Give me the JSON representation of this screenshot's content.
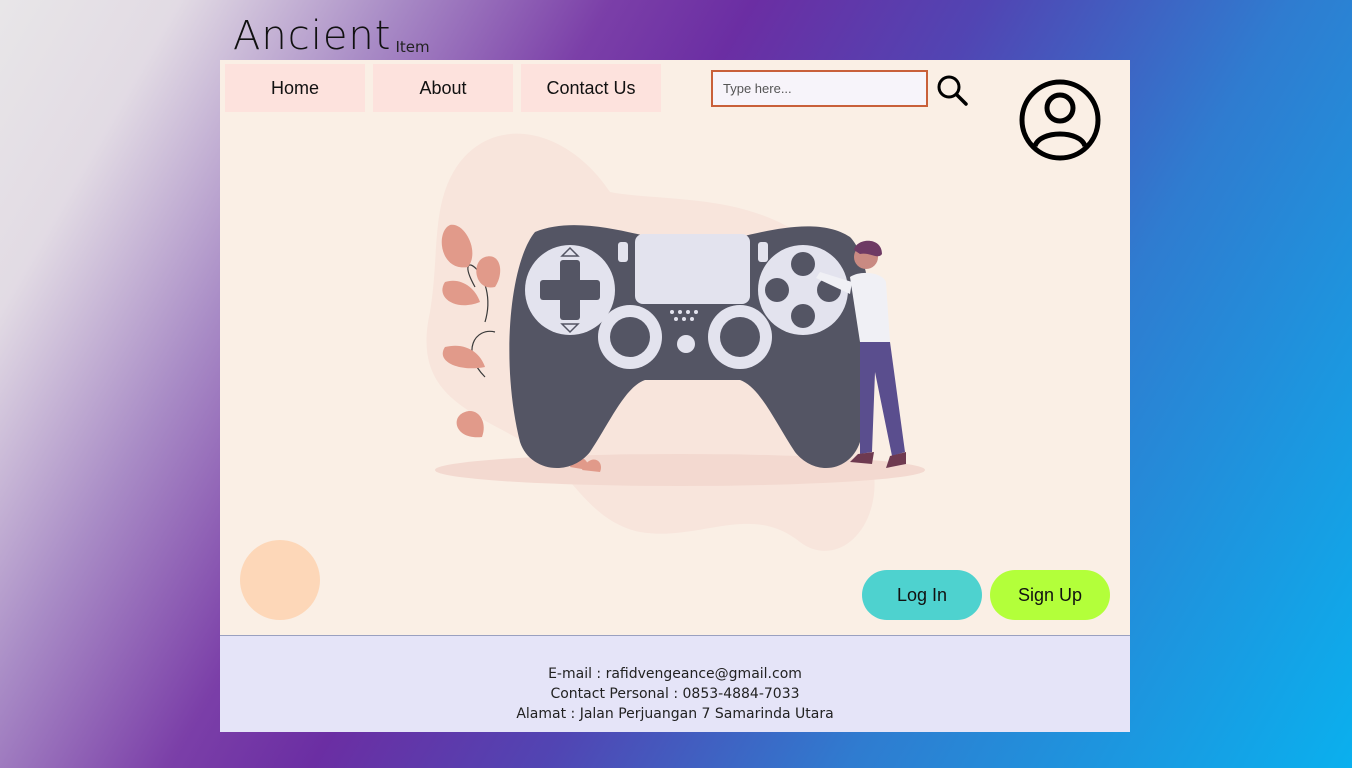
{
  "brand": {
    "name": "Ancient",
    "tag": "Item"
  },
  "nav": {
    "items": [
      {
        "label": "Home"
      },
      {
        "label": "About"
      },
      {
        "label": "Contact Us"
      }
    ]
  },
  "search": {
    "placeholder": "Type here...",
    "value": "",
    "icon": "search-icon"
  },
  "user": {
    "icon": "user-circle-icon"
  },
  "hero": {
    "image": "gamepad-illustration"
  },
  "buttons": {
    "login": "Log In",
    "signup": "Sign Up"
  },
  "footer": {
    "email": "E-mail : rafidvengeance@gmail.com",
    "phone": "Contact Personal : 0853-4884-7033",
    "address": "Alamat : Jalan Perjuangan 7 Samarinda Utara"
  },
  "colors": {
    "panel_bg": "#faefe5",
    "nav_bg": "#fde2dd",
    "login_bg": "#4ed2cf",
    "signup_bg": "#b3ff3a",
    "footer_bg": "#e5e4f8",
    "search_border": "#c9603a"
  }
}
